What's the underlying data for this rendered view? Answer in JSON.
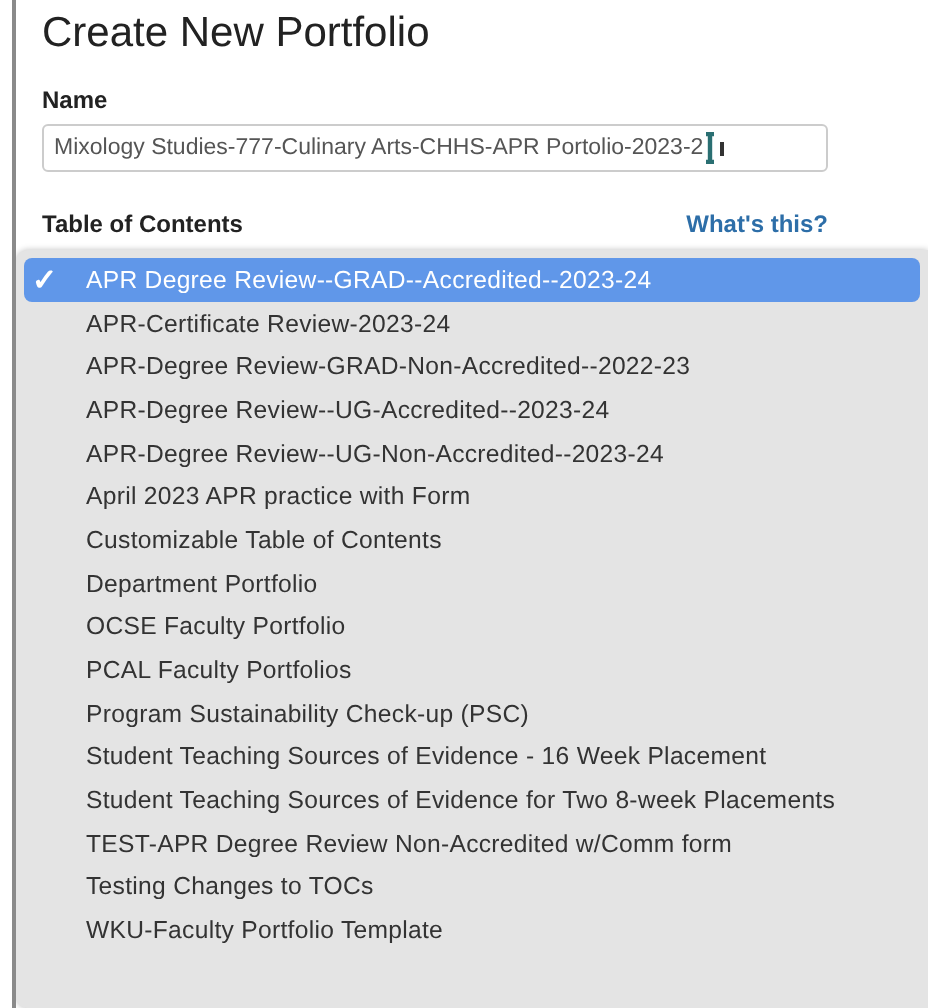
{
  "title": "Create New Portfolio",
  "name_field": {
    "label": "Name",
    "value": "Mixology Studies-777-Culinary Arts-CHHS-APR Portolio-2023-2"
  },
  "toc": {
    "label": "Table of Contents",
    "help_link": "What's this?"
  },
  "menu": {
    "check": "✓",
    "items": [
      {
        "label": "APR Degree Review--GRAD--Accredited--2023-24",
        "selected": true
      },
      {
        "label": "APR-Certificate Review-2023-24",
        "selected": false
      },
      {
        "label": "APR-Degree Review-GRAD-Non-Accredited--2022-23",
        "selected": false
      },
      {
        "label": "APR-Degree Review--UG-Accredited--2023-24",
        "selected": false
      },
      {
        "label": "APR-Degree Review--UG-Non-Accredited--2023-24",
        "selected": false
      },
      {
        "label": "April 2023 APR practice with Form",
        "selected": false
      },
      {
        "label": "Customizable Table of Contents",
        "selected": false
      },
      {
        "label": "Department Portfolio",
        "selected": false
      },
      {
        "label": "OCSE Faculty Portfolio",
        "selected": false
      },
      {
        "label": "PCAL Faculty Portfolios",
        "selected": false
      },
      {
        "label": "Program Sustainability Check-up (PSC)",
        "selected": false
      },
      {
        "label": "Student Teaching Sources of Evidence - 16 Week Placement",
        "selected": false
      },
      {
        "label": "Student Teaching Sources of Evidence for Two 8-week Placements",
        "selected": false
      },
      {
        "label": "TEST-APR Degree Review Non-Accredited w/Comm form",
        "selected": false
      },
      {
        "label": "Testing Changes to TOCs",
        "selected": false
      },
      {
        "label": "WKU-Faculty Portfolio Template",
        "selected": false
      }
    ]
  }
}
